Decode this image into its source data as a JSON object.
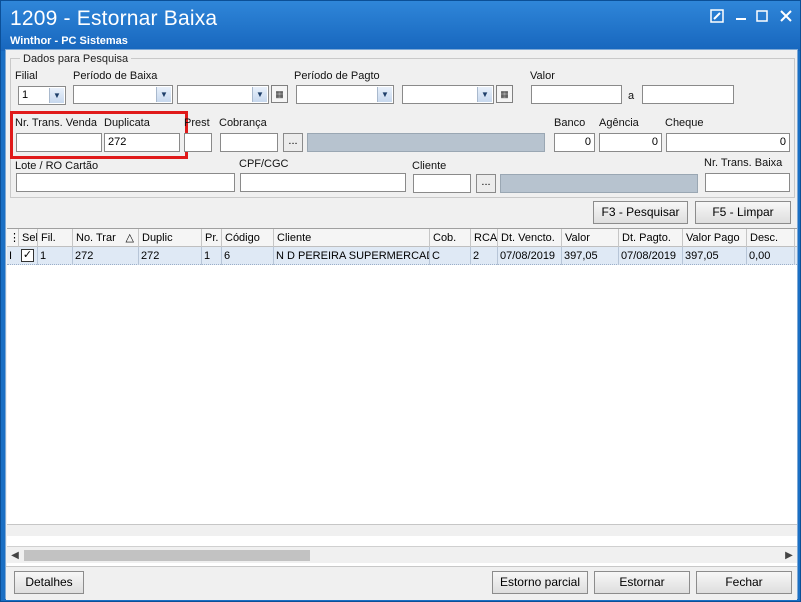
{
  "window": {
    "title": "1209 - Estornar Baixa",
    "subtitle": "Winthor - PC Sistemas"
  },
  "group": {
    "title": "Dados para Pesquisa"
  },
  "filters": {
    "filial_label": "Filial",
    "filial_value": "1",
    "periodo_baixa_label": "Período de Baixa",
    "periodo_pagto_label": "Período de Pagto",
    "valor_label": "Valor",
    "valor_sep": "a",
    "nr_trans_venda_label": "Nr. Trans. Venda",
    "nr_trans_venda_value": "",
    "duplicata_label": "Duplicata",
    "duplicata_value": "272",
    "prest_label": "Prest",
    "cobranca_label": "Cobrança",
    "ellipsis": "...",
    "banco_label": "Banco",
    "banco_value": "0",
    "agencia_label": "Agência",
    "agencia_value": "0",
    "cheque_label": "Cheque",
    "cheque_value": "0",
    "lote_label": "Lote / RO Cartão",
    "cpf_label": "CPF/CGC",
    "cliente_label": "Cliente",
    "nr_trans_baixa_label": "Nr. Trans. Baixa"
  },
  "actions": {
    "pesquisar": "F3 - Pesquisar",
    "limpar": "F5 - Limpar"
  },
  "grid": {
    "columns": [
      "Sel",
      "Fil.",
      "No. Trar",
      "Duplic",
      "Pr.",
      "Código",
      "Cliente",
      "Cob.",
      "RCA",
      "Dt. Vencto.",
      "Valor",
      "Dt. Pagto.",
      "Valor Pago",
      "Desc."
    ],
    "sort_indicator": "△",
    "row_indicator": "I",
    "rows": [
      {
        "sel": "✓",
        "fil": "1",
        "no_trans": "272",
        "duplic": "272",
        "pr": "1",
        "codigo": "6",
        "cliente": "N D PEREIRA SUPERMERCADO",
        "cob": "C",
        "rca": "2",
        "dt_vencto": "07/08/2019",
        "valor": "397,05",
        "dt_pagto": "07/08/2019",
        "valor_pago": "397,05",
        "desc": "0,00"
      }
    ]
  },
  "footer": {
    "detalhes": "Detalhes",
    "estorno_parcial": "Estorno parcial",
    "estornar": "Estornar",
    "fechar": "Fechar"
  },
  "colors": {
    "titlebar": "#1766bd",
    "highlight": "#e01a1a",
    "selected_row": "#dfe9f5"
  }
}
